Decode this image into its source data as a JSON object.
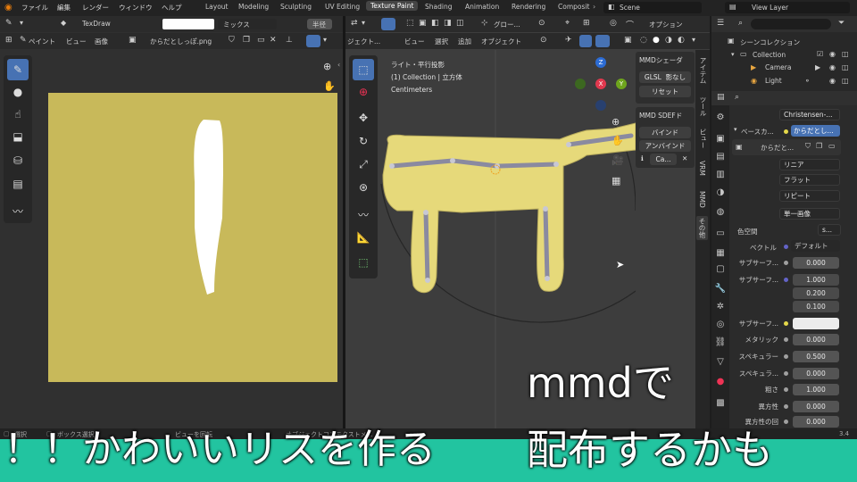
{
  "app": {
    "menus": [
      "ファイル",
      "編集",
      "レンダー",
      "ウィンドウ",
      "ヘルプ"
    ],
    "workspaces": [
      "Layout",
      "Modeling",
      "Sculpting",
      "UV Editing",
      "Texture Paint",
      "Shading",
      "Animation",
      "Rendering",
      "Composit"
    ],
    "active_workspace": "Texture Paint",
    "scene": "Scene",
    "view_layer": "View Layer"
  },
  "image_editor": {
    "brush_name": "TexDraw",
    "blend_mode": "ミックス",
    "radius_label": "半径",
    "mode": "ペイント",
    "menu_view": "ビュー",
    "menu_image": "画像",
    "image_name": "からだとしっぽ.png",
    "texture_color": "#c8b95a",
    "paint_color": "#ffffff"
  },
  "viewport": {
    "mode": "ジェクト...",
    "menus": [
      "ビュー",
      "選択",
      "追加",
      "オブジェクト"
    ],
    "transform_orientation": "グロー...",
    "options": "オプション",
    "overlay_lines": [
      "ライト・平行投影",
      "(1) Collection | 立方体",
      "Centimeters"
    ],
    "gizmo": {
      "z": "Z",
      "x": "X",
      "y": "Y"
    }
  },
  "npanel": {
    "panel1_title": "MMDシェーダ",
    "glsl": "GLSL",
    "shadeless": "影なし",
    "reset": "リセット",
    "panel2_title": "MMD SDEFド",
    "bind": "バインド",
    "unbind": "アンバインド",
    "ca": "Ca...",
    "tabs": [
      "アイテム",
      "ツール",
      "ビュー",
      "VRM",
      "MMD",
      "その他"
    ]
  },
  "outliner": {
    "scene_collection": "シーンコレクション",
    "items": [
      {
        "name": "Collection",
        "indent": 1
      },
      {
        "name": "Camera",
        "indent": 2
      },
      {
        "name": "Light",
        "indent": 2
      }
    ]
  },
  "properties": {
    "shader": "Christensen-...",
    "base_color_label": "ベースカ...",
    "base_color_tex": "からだとし...",
    "image_tex": "からだと...",
    "interpolation": "リニア",
    "projection": "フラット",
    "extension": "リピート",
    "source": "単一画像",
    "colorspace_label": "色空間",
    "colorspace_value": "s...",
    "vector_label": "ベクトル",
    "vector_value": "デフォルト",
    "rows": [
      {
        "label": "サブサーフ...",
        "value": "0.000"
      },
      {
        "label": "サブサーフ...",
        "value": "1.000"
      },
      {
        "label": "",
        "value": "0.200"
      },
      {
        "label": "",
        "value": "0.100"
      },
      {
        "label": "サブサーフ...",
        "value": ""
      },
      {
        "label": "メタリック",
        "value": "0.000"
      },
      {
        "label": "スペキュラー",
        "value": "0.500"
      },
      {
        "label": "スペキュラ...",
        "value": "0.000"
      },
      {
        "label": "粗さ",
        "value": "1.000"
      },
      {
        "label": "異方性",
        "value": "0.000"
      },
      {
        "label": "異方性の回",
        "value": "0.000"
      }
    ]
  },
  "status": {
    "select": "選択",
    "box_select": "ボックス選択",
    "rotate": "ビューを回転",
    "context": "オブジェクトコンテクストメ...",
    "version": "3.4"
  },
  "captions": {
    "right_line1": "mmdで",
    "right_line2": "配布するかも",
    "bottom": "！！かわいいリスを作る"
  },
  "colors": {
    "caption_band": "#22c4a0",
    "accent": "#4772b3",
    "model": "#e6d97a"
  }
}
